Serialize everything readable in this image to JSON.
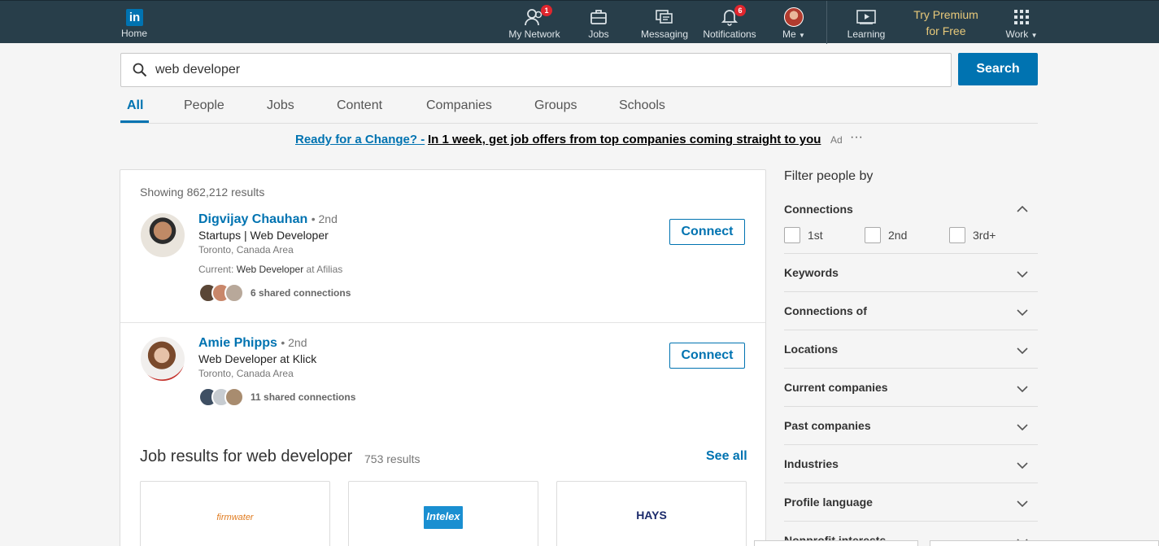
{
  "nav": {
    "home": "Home",
    "items": [
      {
        "label": "My Network",
        "badge": "1"
      },
      {
        "label": "Jobs"
      },
      {
        "label": "Messaging"
      },
      {
        "label": "Notifications",
        "badge": "6"
      },
      {
        "label": "Me"
      },
      {
        "label": "Learning"
      },
      {
        "label": "Work"
      }
    ],
    "premium": "Try Premium for Free"
  },
  "search": {
    "value": "web developer",
    "button": "Search"
  },
  "tabs": [
    "All",
    "People",
    "Jobs",
    "Content",
    "Companies",
    "Groups",
    "Schools"
  ],
  "ad": {
    "link": "Ready for a Change? -",
    "text": "In 1 week, get job offers from top companies coming straight to you",
    "tag": "Ad",
    "more": "···"
  },
  "results": {
    "showing": "Showing 862,212 results",
    "people": [
      {
        "name": "Digvijay Chauhan",
        "degree": "• 2nd",
        "headline": "Startups | Web Developer",
        "location": "Toronto, Canada Area",
        "current_prefix": "Current:",
        "current_role": "Web Developer",
        "current_suffix": "at Afilias",
        "shared": "6 shared connections",
        "action": "Connect"
      },
      {
        "name": "Amie Phipps",
        "degree": "• 2nd",
        "headline": "Web Developer at Klick",
        "location": "Toronto, Canada Area",
        "shared": "11 shared connections",
        "action": "Connect"
      }
    ],
    "jobs_title": "Job results for web developer",
    "jobs_count": "753 results",
    "see_all": "See all",
    "job_logos": [
      "firmwater",
      "Intelex",
      "HAYS"
    ]
  },
  "filters": {
    "title": "Filter people by",
    "connections": {
      "label": "Connections",
      "options": [
        "1st",
        "2nd",
        "3rd+"
      ]
    },
    "sections": [
      "Keywords",
      "Connections of",
      "Locations",
      "Current companies",
      "Past companies",
      "Industries",
      "Profile language",
      "Nonprofit interests"
    ]
  },
  "colors": {
    "nav_bg": "#283e4a",
    "brand_blue": "#0073b1",
    "badge_red": "#e0262e",
    "premium_gold": "#e8c97a"
  }
}
